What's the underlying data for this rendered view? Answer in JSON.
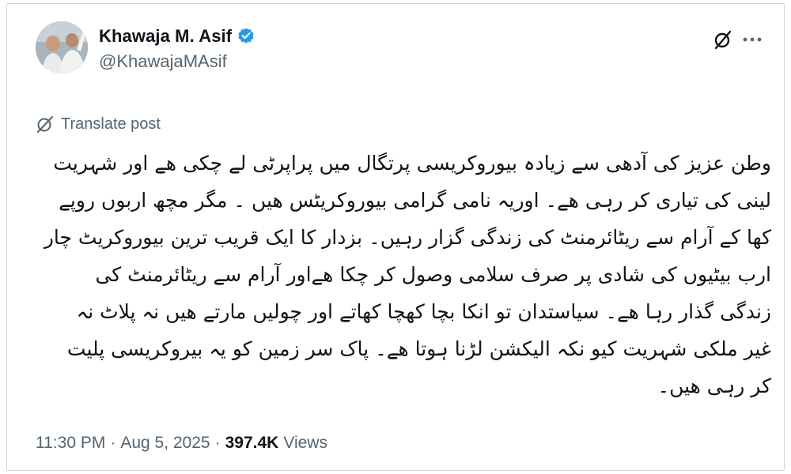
{
  "author": {
    "display_name": "Khawaja M. Asif",
    "handle": "@KhawajaMAsif",
    "verified": true
  },
  "translate_label": "Translate post",
  "post": {
    "lines": [
      "وطن عزیز کی آدھی سے زیادہ بیوروکریسی پرتگال میں پراپرٹی لے چکی ھے اور شہریت",
      "لینی کی تیاری کر رہی ھے۔ اوریہ نامی گرامی بیوروکریٹس ھیں ۔ مگر مچھ اربوں روپے",
      "کھا کے آرام سے ریٹائرمنٹ کی زندگی گزار رہیں۔ بزدار کا ایک قریب ترین بیوروکریٹ چار",
      "ارب بیٹیوں کی شادی پر صرف سلامی وصول کر چکا ھےاور آرام سے ریٹائرمنٹ کی",
      "زندگی گذار رہا ھے۔ سیاستدان تو انکا بچا کھچا کھاتے اور چولیں مارتے ھیں نہ پلاٹ نہ",
      "غیر ملکی شہریت کیو نکہ الیکشن لڑنا ہوتا ھے۔ پاک سر زمین کو یہ بیروکریسی پلیت",
      "کر رہی ھیں۔"
    ]
  },
  "meta": {
    "time": "11:30 PM",
    "separator": "·",
    "date": "Aug 5, 2025",
    "views_count": "397.4K",
    "views_label": "Views"
  },
  "colors": {
    "verified_badge": "#1d9bf0",
    "secondary_text": "#536471",
    "primary_text": "#0f1419"
  },
  "icons": {
    "grok": "grok-icon",
    "more": "more-options-icon",
    "translate": "translate-globe-icon"
  }
}
